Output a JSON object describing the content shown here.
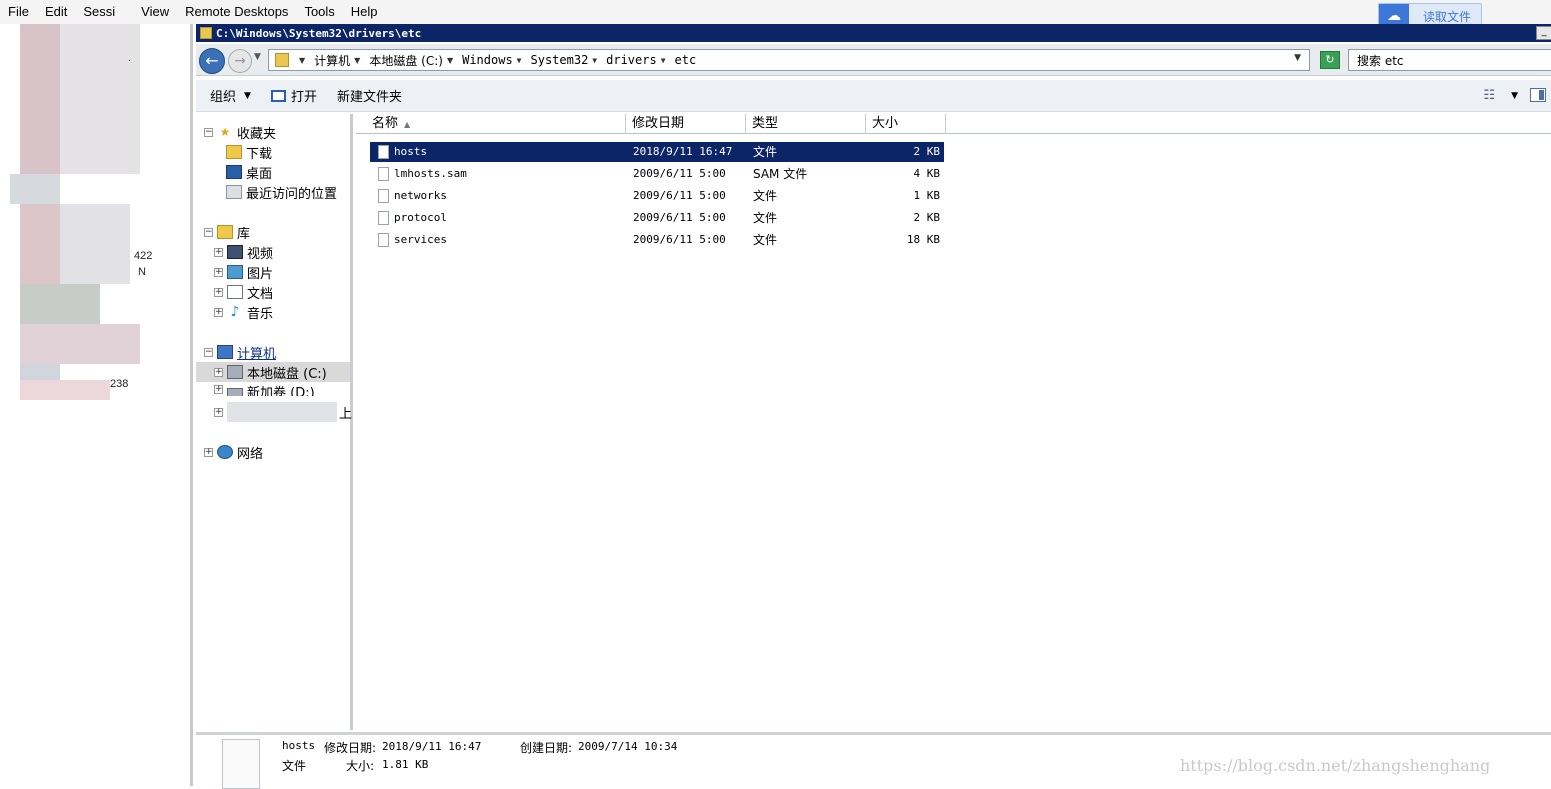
{
  "app_menu": [
    "File",
    "Edit",
    "Sessi",
    "View",
    "Remote Desktops",
    "Tools",
    "Help"
  ],
  "cloud_button": {
    "label": "读取文件"
  },
  "left_panel_fragments": [
    ".",
    "422",
    "N",
    "238"
  ],
  "explorer": {
    "title": "C:\\Windows\\System32\\drivers\\etc",
    "minimize_label": "_",
    "breadcrumb": [
      "计算机",
      "本地磁盘 (C:)",
      "Windows",
      "System32",
      "drivers",
      "etc"
    ],
    "search_placeholder": "搜索 etc",
    "toolbar": {
      "organize": "组织",
      "open": "打开",
      "new_folder": "新建文件夹"
    },
    "nav": {
      "favorites": "收藏夹",
      "favorites_items": [
        "下载",
        "桌面",
        "最近访问的位置"
      ],
      "libraries": "库",
      "library_items": [
        "视频",
        "图片",
        "文档",
        "音乐"
      ],
      "computer": "计算机",
      "drives": [
        "本地磁盘 (C:)",
        "新加卷 (D:)",
        "上"
      ],
      "network": "网络"
    },
    "columns": [
      "名称",
      "修改日期",
      "类型",
      "大小"
    ],
    "files": [
      {
        "name": "hosts",
        "modified": "2018/9/11 16:47",
        "type": "文件",
        "size": "2 KB",
        "selected": true
      },
      {
        "name": "lmhosts.sam",
        "modified": "2009/6/11 5:00",
        "type": "SAM 文件",
        "size": "4 KB",
        "selected": false
      },
      {
        "name": "networks",
        "modified": "2009/6/11 5:00",
        "type": "文件",
        "size": "1 KB",
        "selected": false
      },
      {
        "name": "protocol",
        "modified": "2009/6/11 5:00",
        "type": "文件",
        "size": "2 KB",
        "selected": false
      },
      {
        "name": "services",
        "modified": "2009/6/11 5:00",
        "type": "文件",
        "size": "18 KB",
        "selected": false
      }
    ],
    "details": {
      "name": "hosts",
      "modified_label": "修改日期:",
      "modified_value": "2018/9/11 16:47",
      "created_label": "创建日期:",
      "created_value": "2009/7/14 10:34",
      "type": "文件",
      "size_label": "大小:",
      "size_value": "1.81 KB"
    }
  },
  "watermark": "https://blog.csdn.net/zhangshenghang",
  "colors": {
    "selection": "#0b2566",
    "titlebar": "#0b2566",
    "accent": "#3d78d8"
  }
}
